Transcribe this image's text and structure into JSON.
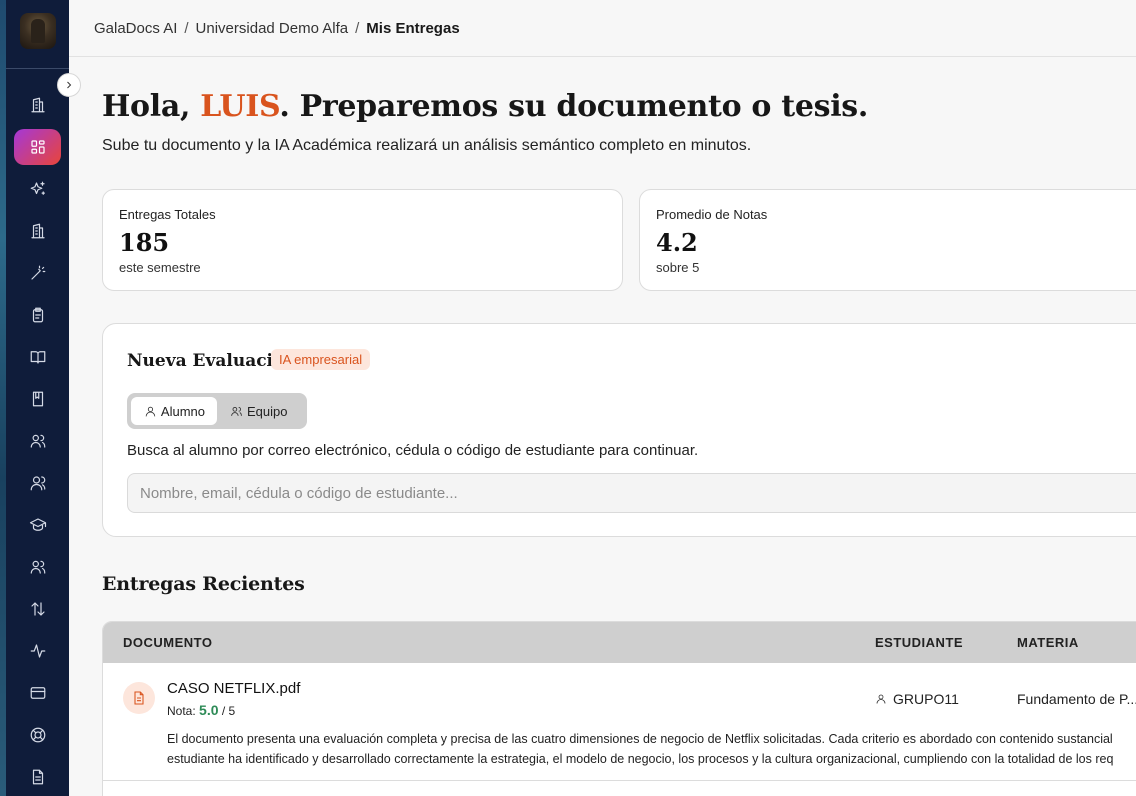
{
  "breadcrumb": [
    "GalaDocs AI",
    "Universidad Demo Alfa",
    "Mis Entregas"
  ],
  "greeting": {
    "prefix": "Hola, ",
    "name": "LUIS",
    "suffix": ". Preparemos su documento o tesis.",
    "subtitle": "Sube tu documento y la IA Académica realizará un análisis semántico completo en minutos."
  },
  "stats": [
    {
      "label": "Entregas Totales",
      "value": "185",
      "sub": "este semestre"
    },
    {
      "label": "Promedio de Notas",
      "value": "4.2",
      "sub": "sobre 5"
    }
  ],
  "evaluation": {
    "title": "Nueva Evaluación",
    "badge": "IA empresarial",
    "toggle": [
      "Alumno",
      "Equipo"
    ],
    "selected_toggle": "Alumno",
    "hint": "Busca al alumno por correo electrónico, cédula o código de estudiante para continuar.",
    "search_placeholder": "Nombre, email, cédula o código de estudiante..."
  },
  "recent": {
    "title": "Entregas Recientes",
    "columns": [
      "DOCUMENTO",
      "ESTUDIANTE",
      "MATERIA"
    ],
    "rows": [
      {
        "document": "CASO NETFLIX.pdf",
        "grade_label": "Nota:",
        "grade": "5.0",
        "grade_max": "/ 5",
        "student": "GRUPO11",
        "subject": "Fundamento de P...",
        "description_line1": "El documento presenta una evaluación completa y precisa de las cuatro dimensiones de negocio de Netflix solicitadas. Cada criterio es abordado con contenido sustancial",
        "description_line2": "estudiante ha identificado y desarrollado correctamente la estrategia, el modelo de negocio, los procesos y la cultura organizacional, cumpliendo con la totalidad de los req"
      }
    ]
  },
  "sidebar_icons": [
    "building-icon",
    "dashboard-icon",
    "sparkles-icon",
    "building-icon",
    "magic-wand-icon",
    "clipboard-icon",
    "open-book-icon",
    "book-icon",
    "users-icon",
    "user-group-icon",
    "graduation-cap-icon",
    "team-icon",
    "sort-arrows-icon",
    "activity-icon",
    "credit-card-icon",
    "lifebuoy-icon",
    "document-icon"
  ],
  "colors": {
    "accent": "#d9541e",
    "sidebar": "#0f1c3a",
    "grade": "#2e8b57"
  }
}
